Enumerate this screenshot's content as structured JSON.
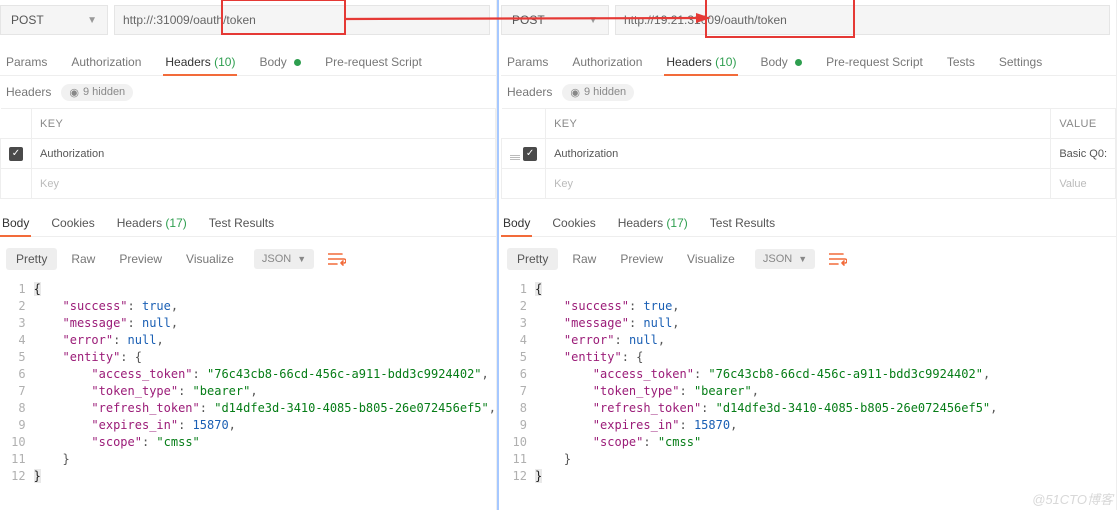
{
  "left": {
    "method": "POST",
    "url_prefix": "http://",
    "url_hidden": "        ",
    "url_suffix": ":31009/oauth/token",
    "tabs": {
      "params": "Params",
      "auth": "Authorization",
      "headers": "Headers",
      "headers_count": "(10)",
      "body": "Body",
      "prescript": "Pre-request Script"
    },
    "headers_label": "Headers",
    "hidden_label": "9 hidden",
    "th_key": "KEY",
    "row_auth": "Authorization",
    "key_placeholder": "Key",
    "resp_tabs": {
      "body": "Body",
      "cookies": "Cookies",
      "headers": "Headers",
      "headers_count": "(17)",
      "tests": "Test Results"
    },
    "viewer": {
      "pretty": "Pretty",
      "raw": "Raw",
      "preview": "Preview",
      "visualize": "Visualize",
      "format": "JSON"
    }
  },
  "right": {
    "method": "POST",
    "url_prefix": "http://19.2",
    "url_hidden": "   ",
    "url_suffix": "1:31009/oauth/token",
    "tabs": {
      "params": "Params",
      "auth": "Authorization",
      "headers": "Headers",
      "headers_count": "(10)",
      "body": "Body",
      "prescript": "Pre-request Script",
      "tests": "Tests",
      "settings": "Settings"
    },
    "headers_label": "Headers",
    "hidden_label": "9 hidden",
    "th_key": "KEY",
    "th_value": "VALUE",
    "row_auth": "Authorization",
    "row_value": "Basic Q0:",
    "key_placeholder": "Key",
    "value_placeholder": "Value",
    "resp_tabs": {
      "body": "Body",
      "cookies": "Cookies",
      "headers": "Headers",
      "headers_count": "(17)",
      "tests": "Test Results"
    },
    "viewer": {
      "pretty": "Pretty",
      "raw": "Raw",
      "preview": "Preview",
      "visualize": "Visualize",
      "format": "JSON"
    }
  },
  "json_response": {
    "success": true,
    "message": null,
    "error": null,
    "entity": {
      "access_token": "76c43cb8-66cd-456c-a911-bdd3c9924402",
      "token_type": "bearer",
      "refresh_token": "d14dfe3d-3410-4085-b805-26e072456ef5",
      "expires_in": 15870,
      "scope": "cmss"
    }
  },
  "watermark": "@51CTO博客"
}
